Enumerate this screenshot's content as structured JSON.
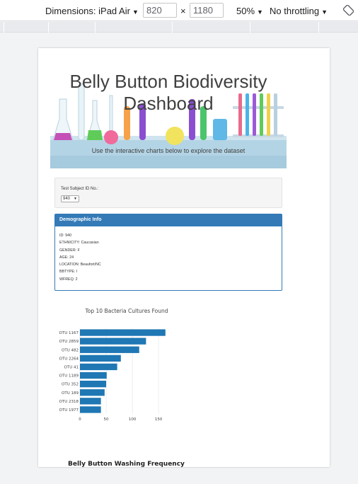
{
  "devtools": {
    "device_label": "Dimensions: iPad Air",
    "width": "820",
    "times": "×",
    "height": "1180",
    "zoom": "50%",
    "throttle": "No throttling"
  },
  "page": {
    "title": "Belly Button Biodiversity Dashboard",
    "lead": "Use the interactive charts below to explore the dataset",
    "selector_label": "Test Subject ID No.:",
    "selected_id": "940",
    "panel_title": "Demographic Info",
    "demographics": [
      "ID: 940",
      "ETHNICITY: Caucasian",
      "GENDER: F",
      "AGE: 24",
      "LOCATION: Beaufort/NC",
      "BBTYPE: I",
      "WFREQ: 2"
    ],
    "gauge_title": "Belly Button Washing Frequency"
  },
  "colors": {
    "bar": "#1f77b4",
    "panel": "#337ab7"
  },
  "chart_data": {
    "type": "bar",
    "orientation": "horizontal",
    "title": "Top 10 Bacteria Cultures Found",
    "categories": [
      "OTU 1167",
      "OTU 2859",
      "OTU 482",
      "OTU 2264",
      "OTU 41",
      "OTU 1189",
      "OTU 352",
      "OTU 189",
      "OTU 2318",
      "OTU 1977"
    ],
    "values": [
      163,
      126,
      113,
      78,
      71,
      51,
      50,
      47,
      40,
      40
    ],
    "xticks": [
      0,
      50,
      100,
      150
    ],
    "xlim": [
      0,
      170
    ],
    "grid": true
  }
}
